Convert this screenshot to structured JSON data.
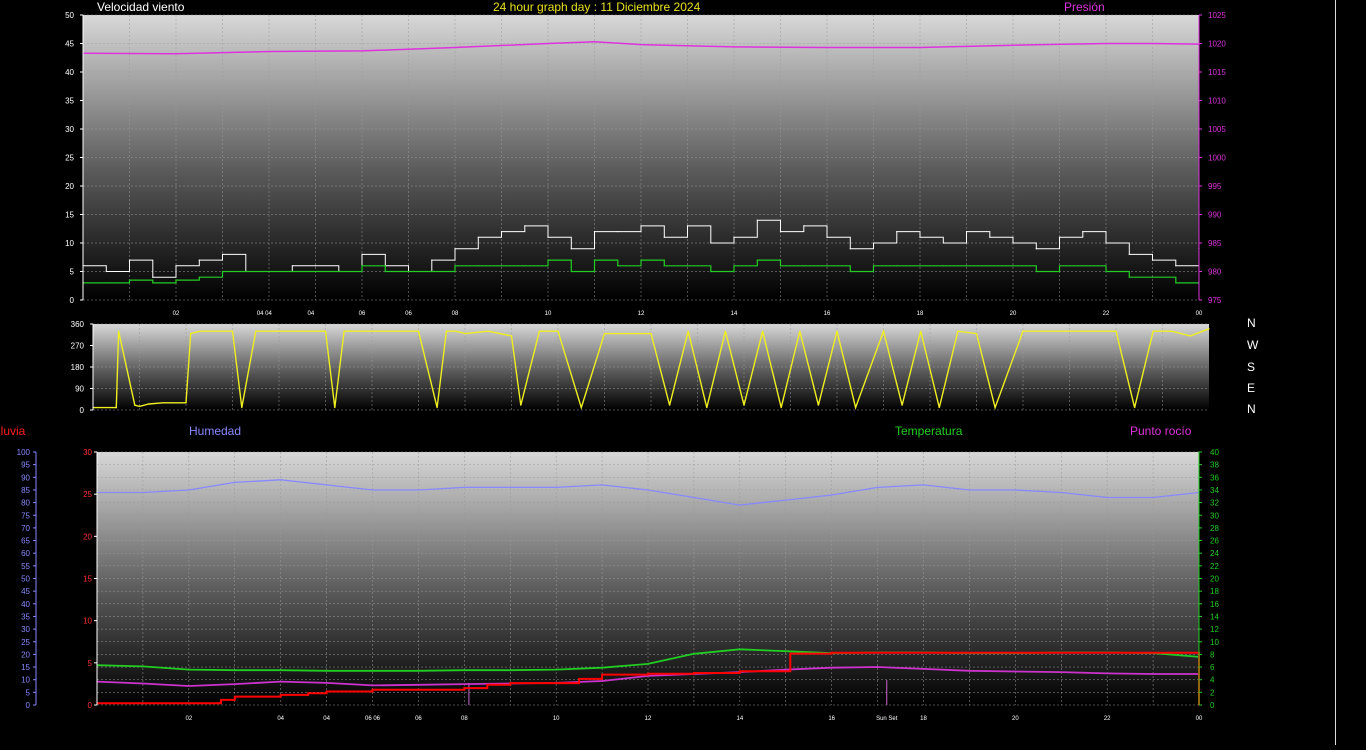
{
  "header": {
    "title_left": "Velocidad viento",
    "title_center": "24 hour graph day : 11 Diciembre 2024",
    "title_right": "Presión"
  },
  "compass": [
    "N",
    "W",
    "S",
    "E",
    "N"
  ],
  "labels": {
    "lluvia": "Lluvia",
    "humedad": "Humedad",
    "temperatura": "Temperatura",
    "punto_rocio": "Punto rocío",
    "sun_set": "Sun Set"
  },
  "colors": {
    "wind_gust": "#ffffff",
    "wind_avg": "#22cc22",
    "pressure": "#dd33dd",
    "direction": "#eeee22",
    "humidity": "#8888ff",
    "temperature": "#22cc22",
    "dewpoint": "#cc33cc",
    "rain": "#ff0000"
  },
  "chart_data": [
    {
      "type": "line",
      "panel": "wind",
      "yleft_ticks": [
        "0",
        "5",
        "10",
        "15",
        "20",
        "25",
        "30",
        "35",
        "40",
        "45",
        "50"
      ],
      "ylim_left": [
        0,
        50
      ],
      "yright_ticks": [
        "975",
        "980",
        "985",
        "990",
        "995",
        "1000",
        "1005",
        "1010",
        "1015",
        "1020",
        "1025"
      ],
      "ylim_right": [
        975,
        1025
      ],
      "x_tick_labels": [
        {
          "h": 2,
          "t": "02"
        },
        {
          "h": 3.9,
          "t": "04 04"
        },
        {
          "h": 4.9,
          "t": "04"
        },
        {
          "h": 6,
          "t": "06"
        },
        {
          "h": 7,
          "t": "06"
        },
        {
          "h": 8,
          "t": "08"
        },
        {
          "h": 10,
          "t": "10"
        },
        {
          "h": 12,
          "t": "12"
        },
        {
          "h": 14,
          "t": "14"
        },
        {
          "h": 16,
          "t": "16"
        },
        {
          "h": 18,
          "t": "18"
        },
        {
          "h": 20,
          "t": "20"
        },
        {
          "h": 22,
          "t": "22"
        },
        {
          "h": 24,
          "t": "00"
        }
      ],
      "series": [
        {
          "name": "Presión",
          "axis": "right",
          "x": [
            0,
            2,
            4,
            6,
            8,
            10,
            11,
            12,
            14,
            16,
            18,
            20,
            22,
            23,
            24
          ],
          "y": [
            1018.3,
            1018.2,
            1018.6,
            1018.7,
            1019.3,
            1020,
            1020.3,
            1019.8,
            1019.4,
            1019.3,
            1019.3,
            1019.7,
            1020,
            1020,
            1019.9
          ]
        },
        {
          "axis": "left",
          "role": "gust",
          "x": [
            0,
            0.5,
            1,
            1.5,
            2,
            2.5,
            3,
            3.5,
            4,
            4.5,
            5,
            5.5,
            6,
            6.5,
            7,
            7.5,
            8,
            8.5,
            9,
            9.5,
            10,
            10.5,
            11,
            11.5,
            12,
            12.5,
            13,
            13.5,
            14,
            14.5,
            15,
            15.5,
            16,
            16.5,
            17,
            17.5,
            18,
            18.5,
            19,
            19.5,
            20,
            20.5,
            21,
            21.5,
            22,
            22.5,
            23,
            23.5,
            24
          ],
          "y": [
            6,
            5,
            7,
            4,
            6,
            7,
            8,
            5,
            5,
            6,
            6,
            5,
            8,
            6,
            5,
            7,
            9,
            11,
            12,
            13,
            11,
            9,
            12,
            12,
            13,
            11,
            13,
            10,
            11,
            14,
            12,
            13,
            11,
            9,
            10,
            12,
            11,
            10,
            12,
            11,
            10,
            9,
            11,
            12,
            10,
            8,
            7,
            6,
            9
          ]
        },
        {
          "axis": "left",
          "role": "average",
          "x": [
            0,
            0.5,
            1,
            1.5,
            2,
            2.5,
            3,
            3.5,
            4,
            4.5,
            5,
            5.5,
            6,
            6.5,
            7,
            7.5,
            8,
            8.5,
            9,
            9.5,
            10,
            10.5,
            11,
            11.5,
            12,
            12.5,
            13,
            13.5,
            14,
            14.5,
            15,
            15.5,
            16,
            16.5,
            17,
            17.5,
            18,
            18.5,
            19,
            19.5,
            20,
            20.5,
            21,
            21.5,
            22,
            22.5,
            23,
            23.5,
            24
          ],
          "y": [
            3,
            3,
            3.5,
            3,
            3.5,
            4,
            5,
            5,
            5,
            5,
            5,
            5,
            6,
            5,
            5,
            5,
            6,
            6,
            6,
            6,
            7,
            5,
            7,
            6,
            7,
            6,
            6,
            5,
            6,
            7,
            6,
            6,
            6,
            5,
            6,
            6,
            6,
            6,
            6,
            6,
            6,
            5,
            6,
            6,
            5,
            4,
            4,
            3,
            3
          ]
        }
      ]
    },
    {
      "type": "line",
      "panel": "direction",
      "yleft_ticks": [
        "0",
        "90",
        "180",
        "270",
        "360"
      ],
      "ylim": [
        0,
        360
      ],
      "series": [
        {
          "axis": "left",
          "role": "direction",
          "x": [
            0,
            0.5,
            0.55,
            0.9,
            1,
            1.2,
            1.5,
            1.7,
            2,
            2.1,
            2.3,
            2.5,
            3,
            3.2,
            3.5,
            4,
            4.5,
            5,
            5.2,
            5.4,
            5.6,
            6,
            6.5,
            7,
            7.4,
            7.6,
            7.8,
            8,
            8.5,
            9,
            9.2,
            9.6,
            10,
            10.5,
            11,
            11.5,
            12,
            12.4,
            12.8,
            13.2,
            13.6,
            14,
            14.4,
            14.8,
            15.2,
            15.6,
            16,
            16.4,
            17,
            17.4,
            17.8,
            18.2,
            18.6,
            19,
            19.4,
            20,
            20.5,
            21,
            21.5,
            22,
            22.4,
            22.8,
            23.2,
            23.6,
            24
          ],
          "y": [
            10,
            10,
            330,
            20,
            15,
            25,
            30,
            30,
            30,
            320,
            330,
            330,
            330,
            10,
            330,
            330,
            330,
            330,
            10,
            330,
            330,
            330,
            330,
            330,
            10,
            330,
            330,
            320,
            330,
            310,
            20,
            330,
            330,
            10,
            320,
            320,
            320,
            20,
            330,
            10,
            330,
            20,
            330,
            10,
            330,
            20,
            330,
            10,
            330,
            20,
            330,
            10,
            330,
            320,
            10,
            330,
            330,
            330,
            330,
            330,
            10,
            330,
            330,
            310,
            340
          ]
        }
      ]
    },
    {
      "type": "line",
      "panel": "climate",
      "yfar_ticks": [
        "0",
        "5",
        "10",
        "15",
        "20",
        "25",
        "30",
        "35",
        "40",
        "45",
        "50",
        "55",
        "60",
        "65",
        "70",
        "75",
        "80",
        "85",
        "90",
        "95",
        "100"
      ],
      "ylim_far": [
        0,
        100
      ],
      "yleft_ticks": [
        "0",
        "5",
        "10",
        "15",
        "20",
        "25",
        "30"
      ],
      "ylim_left": [
        0,
        30
      ],
      "yright_ticks": [
        "0",
        "2",
        "4",
        "6",
        "8",
        "10",
        "12",
        "14",
        "16",
        "18",
        "20",
        "22",
        "24",
        "26",
        "28",
        "30",
        "32",
        "34",
        "36",
        "38",
        "40"
      ],
      "ylim_right": [
        0,
        40
      ],
      "x_tick_labels": [
        {
          "h": 2,
          "t": "02"
        },
        {
          "h": 4,
          "t": "04"
        },
        {
          "h": 5,
          "t": "04"
        },
        {
          "h": 6,
          "t": "06 06"
        },
        {
          "h": 7,
          "t": "06"
        },
        {
          "h": 8,
          "t": "08"
        },
        {
          "h": 10,
          "t": "10"
        },
        {
          "h": 12,
          "t": "12"
        },
        {
          "h": 14,
          "t": "14"
        },
        {
          "h": 16,
          "t": "16"
        },
        {
          "h": 17.2,
          "t": "Sun Set"
        },
        {
          "h": 18,
          "t": "18"
        },
        {
          "h": 20,
          "t": "20"
        },
        {
          "h": 22,
          "t": "22"
        },
        {
          "h": 24,
          "t": "00"
        }
      ],
      "series": [
        {
          "name": "Humedad",
          "axis": "far",
          "x": [
            0,
            1,
            2,
            3,
            4,
            5,
            6,
            7,
            8,
            9,
            10,
            11,
            12,
            13,
            14,
            15,
            16,
            17,
            18,
            19,
            20,
            21,
            22,
            23,
            24
          ],
          "y": [
            84,
            84,
            85,
            88,
            89,
            87,
            85,
            85,
            86,
            86,
            86,
            87,
            85,
            82,
            79,
            81,
            83,
            86,
            87,
            85,
            85,
            84,
            82,
            82,
            84
          ]
        },
        {
          "name": "Temperatura",
          "axis": "right",
          "x": [
            0,
            1,
            2,
            3,
            4,
            5,
            6,
            7,
            8,
            9,
            10,
            11,
            12,
            13,
            14,
            15,
            16,
            17,
            18,
            19,
            20,
            21,
            22,
            23,
            24
          ],
          "y": [
            6.3,
            6.1,
            5.6,
            5.5,
            5.5,
            5.4,
            5.4,
            5.4,
            5.5,
            5.5,
            5.6,
            5.9,
            6.5,
            8.1,
            8.8,
            8.5,
            8.2,
            8.3,
            8.3,
            8.2,
            8.2,
            8.3,
            8.3,
            8.2,
            7.6
          ]
        },
        {
          "name": "Punto rocío",
          "axis": "right",
          "x": [
            0,
            1,
            2,
            3,
            4,
            5,
            6,
            7,
            8,
            9,
            10,
            11,
            12,
            13,
            14,
            15,
            16,
            17,
            18,
            19,
            20,
            21,
            22,
            23,
            24
          ],
          "y": [
            3.7,
            3.4,
            3.0,
            3.3,
            3.7,
            3.5,
            3.1,
            3.2,
            3.3,
            3.4,
            3.5,
            3.8,
            4.6,
            4.9,
            5.2,
            5.6,
            5.9,
            6.0,
            5.7,
            5.4,
            5.3,
            5.2,
            5.0,
            4.9,
            4.9
          ]
        },
        {
          "name": "Lluvia",
          "axis": "left",
          "x": [
            0,
            0.5,
            1,
            2,
            2.7,
            3,
            4,
            4.6,
            5,
            6,
            7,
            8,
            8.5,
            9,
            10,
            10.5,
            11,
            12,
            13,
            14,
            14.5,
            15,
            15.1,
            16,
            17,
            18,
            19,
            20,
            21,
            22,
            23,
            23.9,
            24
          ],
          "y": [
            0.2,
            0.2,
            0.2,
            0.2,
            0.6,
            1.0,
            1.2,
            1.4,
            1.6,
            1.8,
            1.8,
            2.0,
            2.4,
            2.6,
            2.6,
            3.1,
            3.6,
            3.7,
            3.8,
            4.0,
            4.0,
            4.0,
            6.1,
            6.2,
            6.2,
            6.2,
            6.2,
            6.2,
            6.2,
            6.2,
            6.2,
            6.2,
            0.0
          ]
        }
      ]
    }
  ]
}
